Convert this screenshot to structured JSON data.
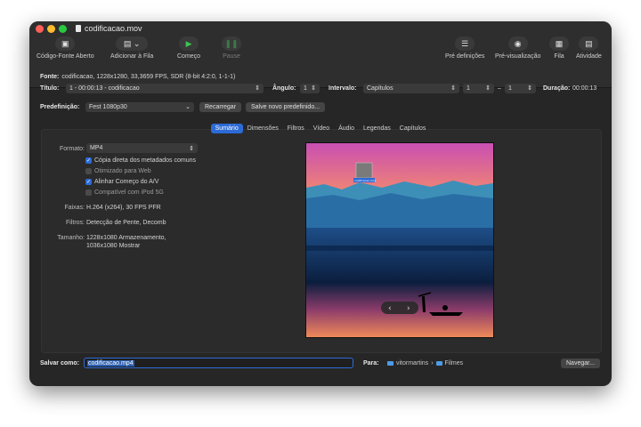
{
  "window": {
    "title": "codificacao.mov"
  },
  "toolbar": {
    "source": "Código-Fonte Aberto",
    "add_queue": "Adicionar à Fila",
    "start": "Começo",
    "pause": "Pause",
    "presets": "Pré definições",
    "preview": "Pré-visualização",
    "queue": "Fila",
    "activity": "Atividade"
  },
  "source": {
    "label": "Fonte:",
    "value": "codificacao, 1228x1280, 33,3659 FPS, SDR (8-bit 4:2:0, 1-1-1)"
  },
  "title_row": {
    "title_label": "Título:",
    "title_value": "1 - 00:00:13 - codificacao",
    "angle_label": "Ângulo:",
    "angle_value": "1",
    "range_label": "Intervalo:",
    "range_value": "Capítulos",
    "range_from": "1",
    "range_sep": "–",
    "range_to": "1",
    "duration_label": "Duração:",
    "duration_value": "00:00:13"
  },
  "preset_row": {
    "label": "Predefinição:",
    "value": "Fest 1080p30",
    "reload": "Recarregar",
    "save_new": "Salve novo predefinido..."
  },
  "tabs": [
    "Sumário",
    "Dimensões",
    "Filtros",
    "Vídeo",
    "Áudio",
    "Legendas",
    "Capítulos"
  ],
  "summary": {
    "format_label": "Formato:",
    "format_value": "MP4",
    "options": [
      {
        "label": "Cópia direta dos metadados comuns",
        "checked": true
      },
      {
        "label": "Otimizado para Web",
        "checked": false
      },
      {
        "label": "Alinhar Começo do A/V",
        "checked": true
      },
      {
        "label": "Compatível com iPod 5G",
        "checked": false
      }
    ],
    "tracks_label": "Faixas:",
    "tracks_value": "H.264 (x264), 30 FPS PFR",
    "filters_label": "Filtros:",
    "filters_value": "Detecção de Pente, Decomb",
    "size_label": "Tamanho:",
    "size_value_1": "1228x1080 Armazenamento,",
    "size_value_2": "1036x1080 Mostrar"
  },
  "preview": {
    "thumb_label": "codificacao.mov",
    "prev": "‹",
    "next": "›",
    "colors": {
      "sky_top": "#c94fb3",
      "sky_mid": "#ff9a5a",
      "water": "#1d4e88",
      "deep": "#0b1e3e"
    }
  },
  "save": {
    "label": "Salvar como:",
    "filename": "codificacao.mp4",
    "to_label": "Para:",
    "user": "vitormartins",
    "sep": "›",
    "folder": "Filmes",
    "browse": "Navegar..."
  },
  "accent": "#2d6bd6"
}
